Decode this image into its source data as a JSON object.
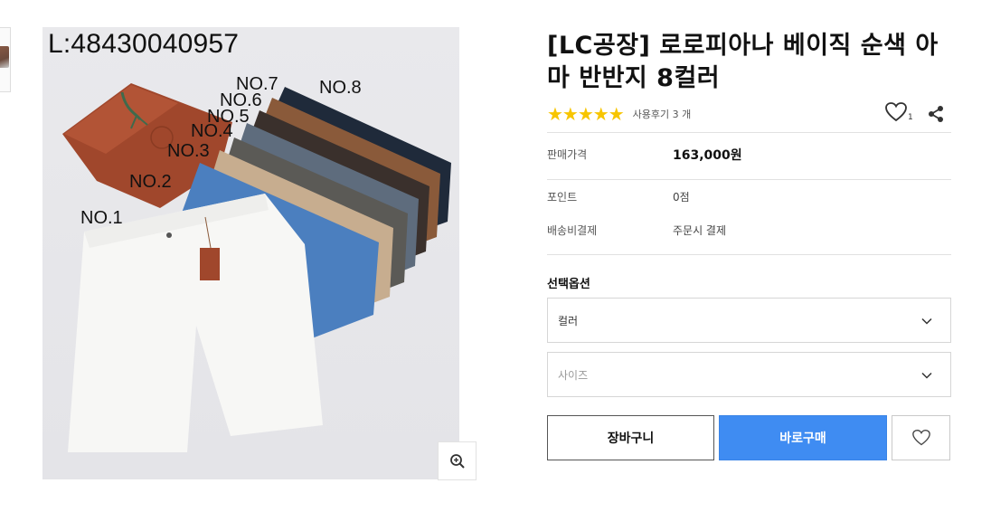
{
  "product": {
    "title": "[LC공장] 로로피아나 베이직 순색 아마 반반지 8컬러",
    "image_text": {
      "sku": "L:48430040957",
      "labels": [
        "NO.1",
        "NO.2",
        "NO.3",
        "NO.4",
        "NO.5",
        "NO.6",
        "NO.7",
        "NO.8"
      ]
    },
    "rating": {
      "stars": "★★★★★",
      "review_text": "사용후기 3 개"
    },
    "wishlist_count": "1"
  },
  "info_rows": {
    "price_label": "판매가격",
    "price_value": "163,000원",
    "point_label": "포인트",
    "point_value": "0점",
    "shipping_label": "배송비결제",
    "shipping_value": "주문시 결제"
  },
  "options": {
    "title": "선택옵션",
    "color_select": "컬러",
    "size_select": "사이즈"
  },
  "actions": {
    "cart_label": "장바구니",
    "buy_label": "바로구매"
  },
  "colors": {
    "accent": "#3f8cf2",
    "star": "#f7c500"
  },
  "icons": {
    "zoom": "zoom-in-icon",
    "wish": "heart-icon",
    "share": "share-icon",
    "chevron": "chevron-down-icon"
  }
}
